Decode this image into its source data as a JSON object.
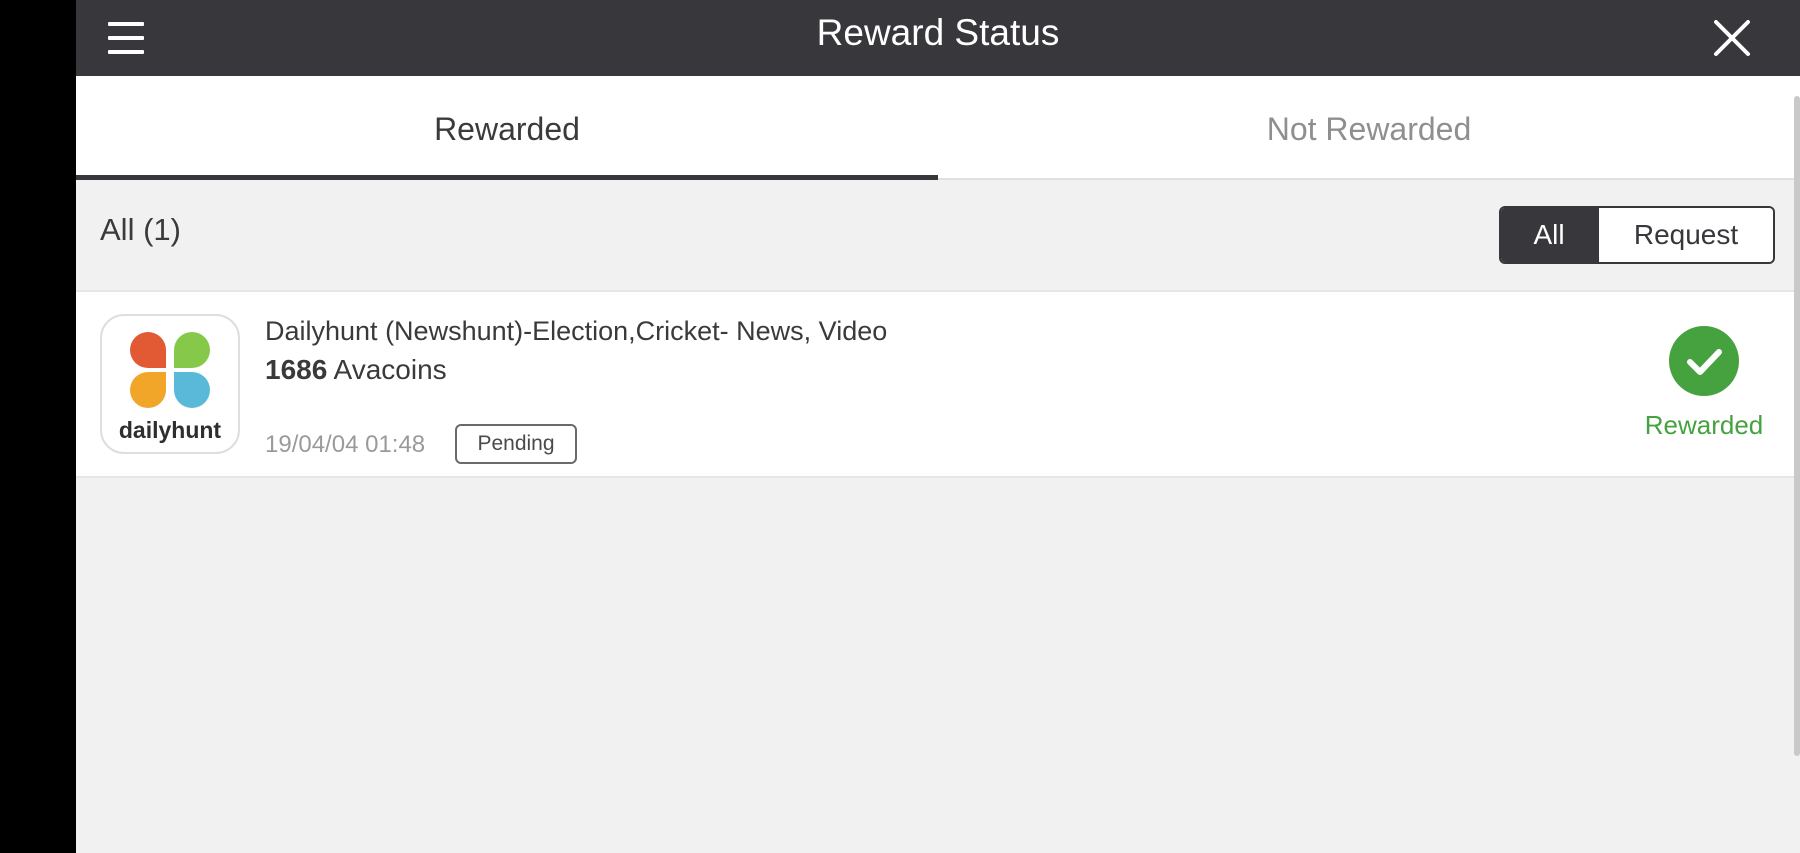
{
  "header": {
    "title": "Reward Status",
    "menu_icon": "hamburger-menu-icon",
    "close_icon": "close-icon"
  },
  "tabs": [
    {
      "label": "Rewarded",
      "active": true
    },
    {
      "label": "Not Rewarded",
      "active": false
    }
  ],
  "filter": {
    "count_label": "All (1)",
    "options": [
      {
        "label": "All",
        "selected": true
      },
      {
        "label": "Request",
        "selected": false
      }
    ]
  },
  "rewards": [
    {
      "app_name": "Dailyhunt (Newshunt)-Election,Cricket- News, Video",
      "coins_amount": "1686",
      "coins_unit": "Avacoins",
      "date": "19/04/04 01:48",
      "badge": "Pending",
      "status": "Rewarded",
      "icon_text": "dailyhunt",
      "status_icon": "checkmark-circle-icon"
    }
  ],
  "colors": {
    "header_bg": "#38373c",
    "screen_bg": "#f1f1f1",
    "success": "#46a23f",
    "inactive_tab": "#8f8f8f",
    "logo_red": "#e25a33",
    "logo_green": "#86c94a",
    "logo_orange": "#f1a62a",
    "logo_blue": "#5ab8d9"
  }
}
